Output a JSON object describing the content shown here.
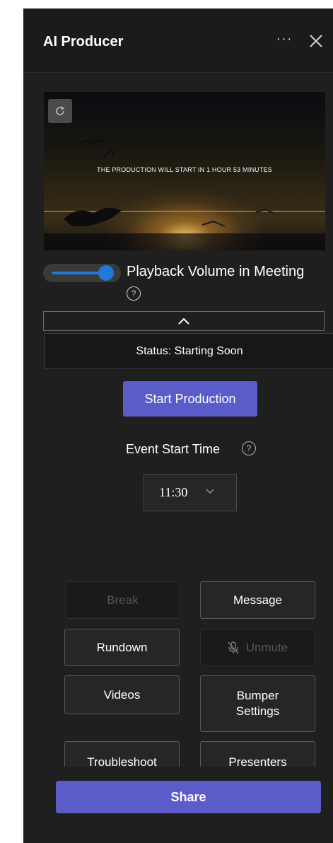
{
  "header": {
    "title": "AI Producer",
    "more_label": "···"
  },
  "preview": {
    "overlay_text": "THE PRODUCTION WILL START IN 1 HOUR 53 MINUTES"
  },
  "volume": {
    "label": "Playback Volume in Meeting",
    "help": "?",
    "level": 0.9
  },
  "status": {
    "text": "Status: Starting Soon"
  },
  "production": {
    "start_label": "Start Production"
  },
  "event": {
    "label": "Event Start Time",
    "help": "?",
    "time_value": "11:30"
  },
  "controls": {
    "break": "Break",
    "message": "Message",
    "rundown": "Rundown",
    "unmute": "Unmute",
    "videos": "Videos",
    "bumper_line1": "Bumper",
    "bumper_line2": "Settings",
    "troubleshoot": "Troubleshoot",
    "presenters": "Presenters"
  },
  "footer": {
    "share_label": "Share"
  },
  "colors": {
    "accent": "#5b5bc9",
    "slider": "#1f7ad8",
    "panel_bg": "#1f1f1f"
  }
}
